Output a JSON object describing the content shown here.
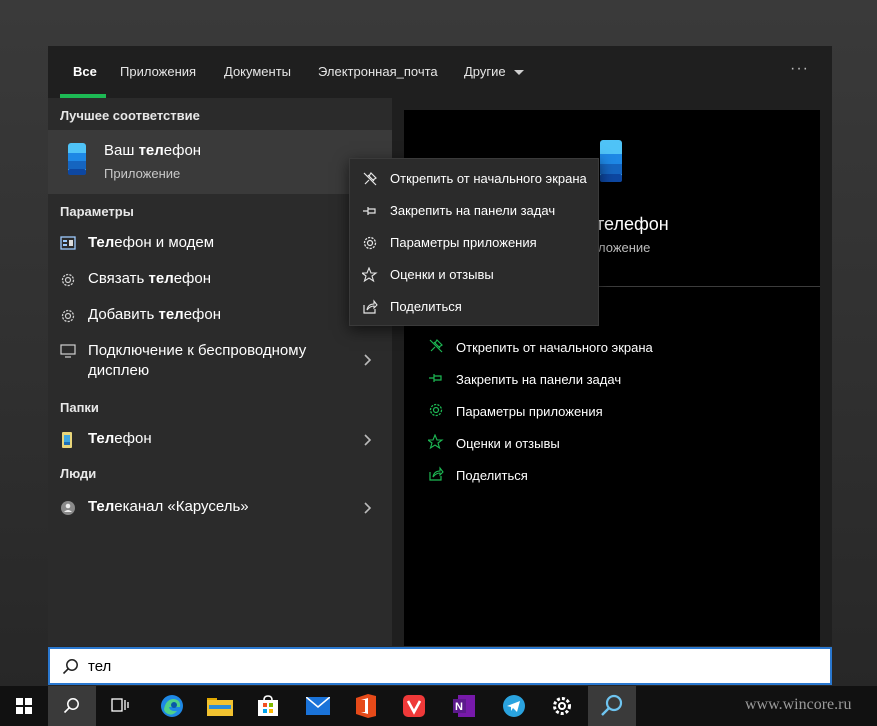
{
  "tabs": [
    {
      "label": "Все"
    },
    {
      "label": "Приложения"
    },
    {
      "label": "Документы"
    },
    {
      "label": "Электронная_почта"
    },
    {
      "label": "Другие"
    }
  ],
  "tabs_more": "···",
  "left": {
    "best_match_title": "Лучшее соответствие",
    "best_match": {
      "name_pre": "Ваш ",
      "name_bold": "тел",
      "name_post": "ефон",
      "type": "Приложение"
    },
    "settings_title": "Параметры",
    "settings_items": [
      {
        "pre": "",
        "bold": "Тел",
        "post": "ефон и модем",
        "icon": "phone-modem-icon"
      },
      {
        "pre": "Связать ",
        "bold": "тел",
        "post": "ефон",
        "icon": "gear-icon"
      },
      {
        "pre": "Добавить ",
        "bold": "тел",
        "post": "ефон",
        "icon": "gear-icon"
      },
      {
        "pre": "",
        "bold": "",
        "post": "Подключение к беспроводному",
        "post2": "дисплею",
        "icon": "monitor-icon"
      }
    ],
    "folders_title": "Папки",
    "folders_items": [
      {
        "pre": "",
        "bold": "Тел",
        "post": "ефон",
        "icon": "folder-icon"
      }
    ],
    "people_title": "Люди",
    "people_items": [
      {
        "pre": "",
        "bold": "Тел",
        "post": "еканал «Карусель»",
        "icon": "person-icon"
      }
    ]
  },
  "preview": {
    "title": "телефон",
    "subtitle": "ложение",
    "actions": [
      {
        "label": "Открепить от начального экрана",
        "icon": "unpin-icon"
      },
      {
        "label": "Закрепить на панели задач",
        "icon": "pin-icon"
      },
      {
        "label": "Параметры приложения",
        "icon": "gear-icon"
      },
      {
        "label": "Оценки и отзывы",
        "icon": "rate-icon"
      },
      {
        "label": "Поделиться",
        "icon": "share-icon"
      }
    ]
  },
  "context_menu": [
    {
      "label": "Открепить от начального экрана",
      "icon": "unpin-icon"
    },
    {
      "label": "Закрепить на панели задач",
      "icon": "pin-icon"
    },
    {
      "label": "Параметры приложения",
      "icon": "gear-icon"
    },
    {
      "label": "Оценки и отзывы",
      "icon": "rate-icon"
    },
    {
      "label": "Поделиться",
      "icon": "share-icon"
    }
  ],
  "search": {
    "value": "тел"
  },
  "taskbar": {
    "items": [
      "windows-start-icon",
      "search-icon",
      "task-view-icon",
      "edge-icon",
      "file-explorer-icon",
      "store-icon",
      "mail-icon",
      "office-icon",
      "vivaldi-icon",
      "onenote-icon",
      "telegram-icon",
      "settings-icon",
      "search-app-icon"
    ],
    "watermark": "www.wincore.ru"
  },
  "colors": {
    "accent": "#1db954",
    "panel": "#1f1f1f",
    "left": "#2b2b2b",
    "preview": "#000000",
    "highlight": "#3a3a3a"
  }
}
